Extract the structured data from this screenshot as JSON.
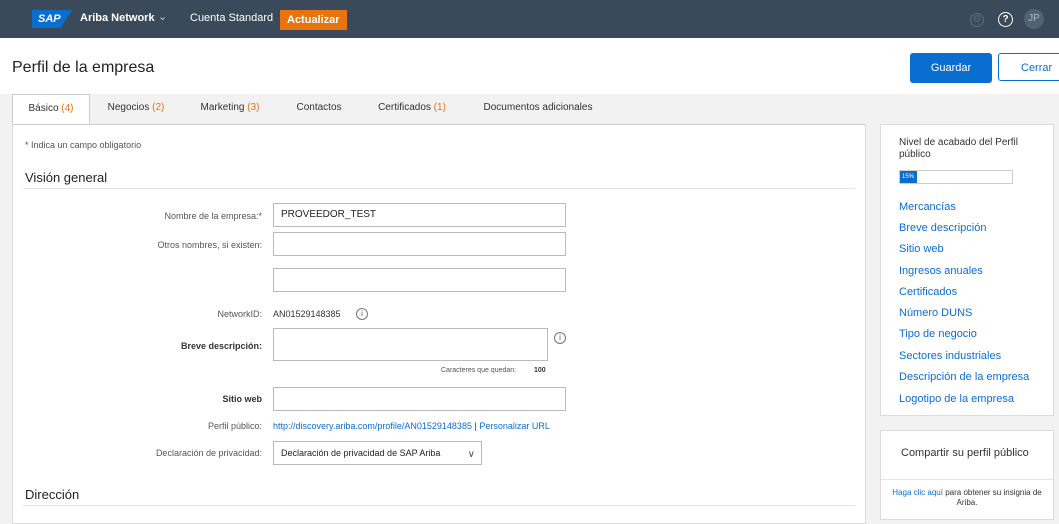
{
  "topbar": {
    "logo": "SAP",
    "network": "Ariba Network",
    "caret": "⌄",
    "account": "Cuenta Standard",
    "update_button": "Actualizar",
    "settings_icon": "gear-icon",
    "help_icon": "help-icon",
    "help_glyph": "?",
    "avatar": "JP",
    "gear_glyph": "⚙"
  },
  "header": {
    "title": "Perfil de la empresa",
    "save_button": "Guardar",
    "close_button": "Cerrar"
  },
  "tabs": [
    {
      "label": "Básico",
      "count": "(4)"
    },
    {
      "label": "Negocios",
      "count": "(2)"
    },
    {
      "label": "Marketing",
      "count": "(3)"
    },
    {
      "label": "Contactos",
      "count": ""
    },
    {
      "label": "Certificados",
      "count": "(1)"
    },
    {
      "label": "Documentos adicionales",
      "count": ""
    }
  ],
  "form": {
    "required_note": "* Indica un campo obligatorio",
    "section_overview": "Visión general",
    "company_name_label": "Nombre de la empresa:*",
    "company_name_value": "PROVEEDOR_TEST",
    "other_names_label": "Otros nombres, si existen:",
    "other_names_value": "",
    "other_names_value2": "",
    "network_id_label": "NetworkID:",
    "network_id_value": "AN01529148385",
    "info_glyph": "i",
    "short_desc_label": "Breve descripción:",
    "short_desc_value": "",
    "chars_left_label": "Caracteres que quedan:",
    "chars_left_value": "100",
    "website_label": "Sitio web",
    "website_value": "",
    "public_profile_label": "Perfil público:",
    "public_profile_url": "http://discovery.ariba.com/profile/AN01529148385",
    "separator": "|",
    "customize_url": "Personalizar URL",
    "privacy_label": "Declaración de privacidad:",
    "privacy_value": "Declaración de privacidad de SAP Ariba",
    "privacy_chevron": "∨",
    "section_address": "Dirección"
  },
  "completion_panel": {
    "title": "Nivel de acabado del Perfil público",
    "progress_percent": 15,
    "progress_label": "15%",
    "links": [
      "Mercancías",
      "Breve descripción",
      "Sitio web",
      "Ingresos anuales",
      "Certificados",
      "Número DUNS",
      "Tipo de negocio",
      "Sectores industriales",
      "Descripción de la empresa",
      "Logotipo de la empresa"
    ]
  },
  "share_panel": {
    "title": "Compartir su perfil público",
    "link_text": "Haga clic aquí",
    "rest_text": " para obtener su insignia de Ariba."
  },
  "colors": {
    "accent": "#0a6ed1",
    "update": "#e9730c",
    "topbar": "#3a4a5a"
  }
}
